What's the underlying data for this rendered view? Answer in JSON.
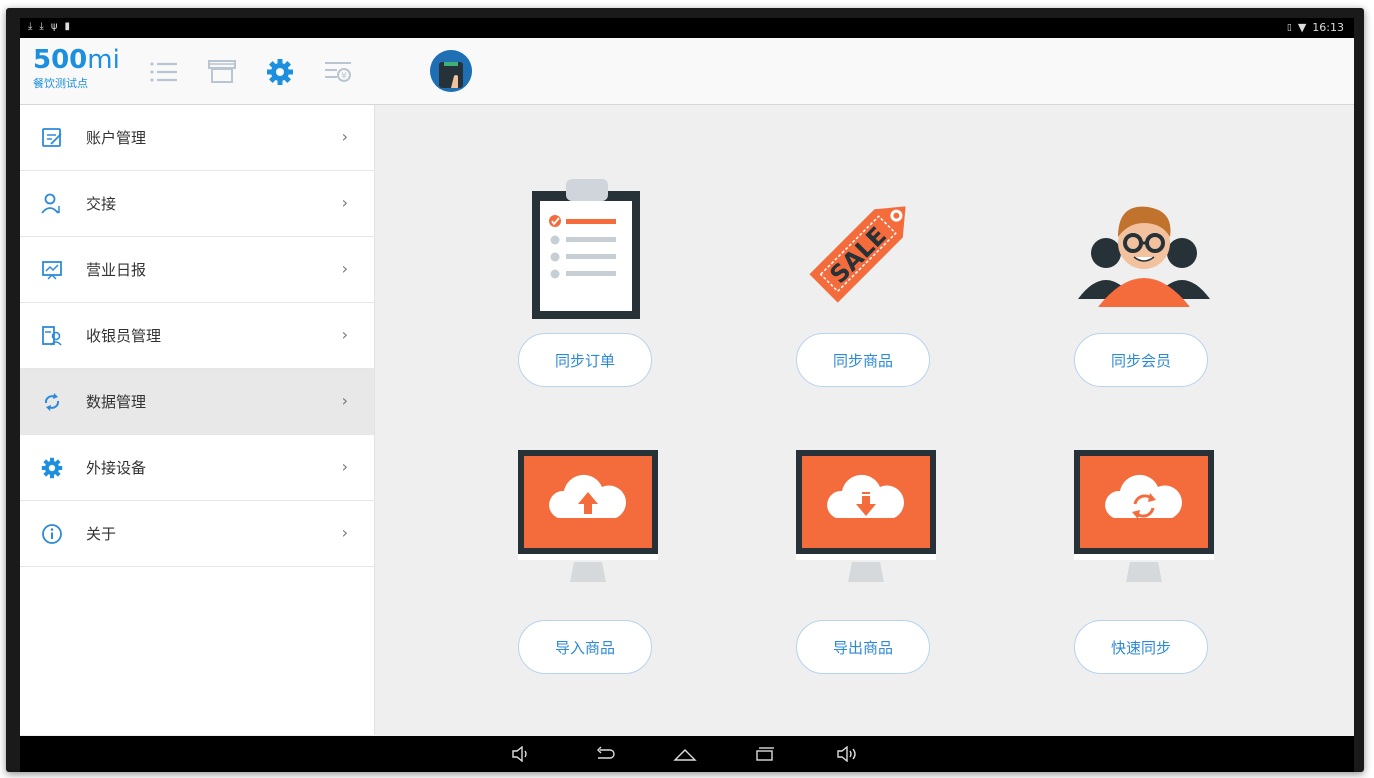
{
  "status_bar": {
    "left_icons": [
      "download-icon",
      "download-icon",
      "usb-icon",
      "battery-card-icon"
    ],
    "time": "16:13"
  },
  "brand": {
    "logo_number": "500",
    "logo_text": "mi",
    "store_name": "餐饮测试点",
    "color": "#1d8fe0"
  },
  "top_nav": {
    "icons": [
      "list-icon",
      "store-icon",
      "settings-gear-icon",
      "cash-register-icon",
      "user-avatar-icon"
    ],
    "active": "settings-gear-icon"
  },
  "sidebar": {
    "items": [
      {
        "label": "账户管理",
        "icon": "account-edit-icon"
      },
      {
        "label": "交接",
        "icon": "user-handover-icon"
      },
      {
        "label": "营业日报",
        "icon": "daily-report-icon"
      },
      {
        "label": "收银员管理",
        "icon": "cashier-manage-icon"
      },
      {
        "label": "数据管理",
        "icon": "data-sync-icon"
      },
      {
        "label": "外接设备",
        "icon": "device-gear-icon"
      },
      {
        "label": "关于",
        "icon": "info-icon"
      }
    ],
    "active_index": 4,
    "chevron": "›"
  },
  "actions": [
    {
      "label": "同步订单",
      "icon": "clipboard-order-icon"
    },
    {
      "label": "同步商品",
      "icon": "sale-tag-icon"
    },
    {
      "label": "同步会员",
      "icon": "members-icon"
    },
    {
      "label": "导入商品",
      "icon": "cloud-upload-monitor-icon"
    },
    {
      "label": "导出商品",
      "icon": "cloud-download-monitor-icon"
    },
    {
      "label": "快速同步",
      "icon": "cloud-sync-monitor-icon"
    }
  ],
  "sale_tag_text": "SALE",
  "colors": {
    "accent": "#2d8ad8",
    "orange": "#f46b3c",
    "dark": "#263238"
  },
  "nav_bar": [
    "volume-down-icon",
    "back-icon",
    "home-icon",
    "recents-icon",
    "volume-up-icon"
  ]
}
